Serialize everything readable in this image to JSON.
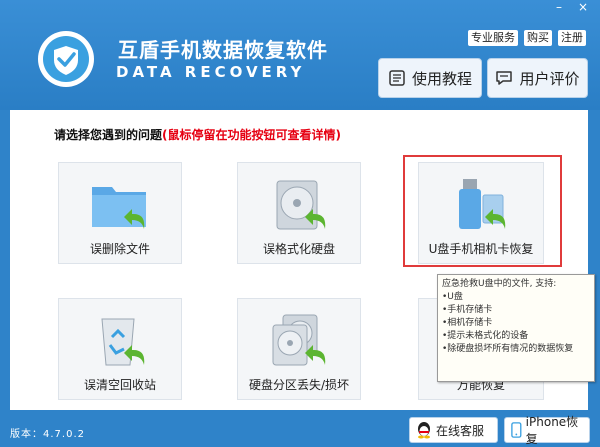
{
  "window": {
    "minimize": "–",
    "close": "×"
  },
  "app": {
    "title": "互盾手机数据恢复软件",
    "subtitle": "DATA RECOVERY"
  },
  "top_links": [
    "专业服务",
    "购买",
    "注册"
  ],
  "header_buttons": [
    {
      "label": "使用教程",
      "icon": "book-icon"
    },
    {
      "label": "用户评价",
      "icon": "comment-icon"
    }
  ],
  "prompt": {
    "main": "请选择您遇到的问题",
    "hint": "(鼠标停留在功能按钮可查看详情)"
  },
  "tiles": [
    {
      "label": "误删除文件",
      "icon": "folder-icon"
    },
    {
      "label": "误格式化硬盘",
      "icon": "disk-icon"
    },
    {
      "label": "U盘手机相机卡恢复",
      "icon": "usb-card-icon"
    },
    {
      "label": "误清空回收站",
      "icon": "recycle-bin-icon"
    },
    {
      "label": "硬盘分区丢失/损坏",
      "icon": "partition-icon"
    },
    {
      "label": "万能恢复",
      "icon": "universal-icon"
    }
  ],
  "tooltip": {
    "lines": [
      "应急抢救U盘中的文件, 支持:",
      "",
      "•U盘",
      "•手机存储卡",
      "•相机存储卡",
      "•提示未格式化的设备",
      "•除硬盘损坏所有情况的数据恢复"
    ]
  },
  "footer": {
    "version": "版本：4.7.0.2",
    "buttons": [
      {
        "label": "在线客服",
        "icon": "qq-icon"
      },
      {
        "label": "iPhone恢复",
        "icon": "iphone-icon"
      }
    ]
  },
  "colors": {
    "brand_blue": "#2f83c9",
    "hint_red": "#e60012",
    "select_red": "#e03b3b",
    "arrow_green": "#5cb531"
  }
}
